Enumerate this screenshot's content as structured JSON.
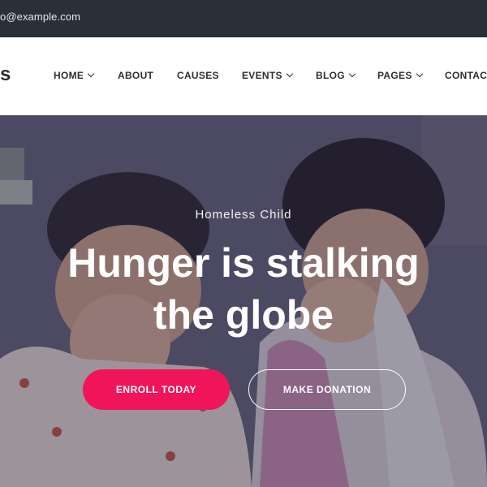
{
  "topbar": {
    "email": "o@example.com"
  },
  "header": {
    "logo_text": "s",
    "nav": [
      {
        "label": "HOME",
        "has_dropdown": true
      },
      {
        "label": "ABOUT",
        "has_dropdown": false
      },
      {
        "label": "CAUSES",
        "has_dropdown": false
      },
      {
        "label": "EVENTS",
        "has_dropdown": true
      },
      {
        "label": "BLOG",
        "has_dropdown": true
      },
      {
        "label": "PAGES",
        "has_dropdown": true
      },
      {
        "label": "CONTACT",
        "has_dropdown": false
      }
    ]
  },
  "hero": {
    "subtitle": "Homeless Child",
    "headline_line1": "Hunger is stalking",
    "headline_line2": "the globe",
    "primary_button": "ENROLL TODAY",
    "secondary_button": "MAKE DONATION"
  },
  "colors": {
    "topbar": "#2b3038",
    "accent": "#f0155a",
    "nav_text": "#2c2f36"
  }
}
